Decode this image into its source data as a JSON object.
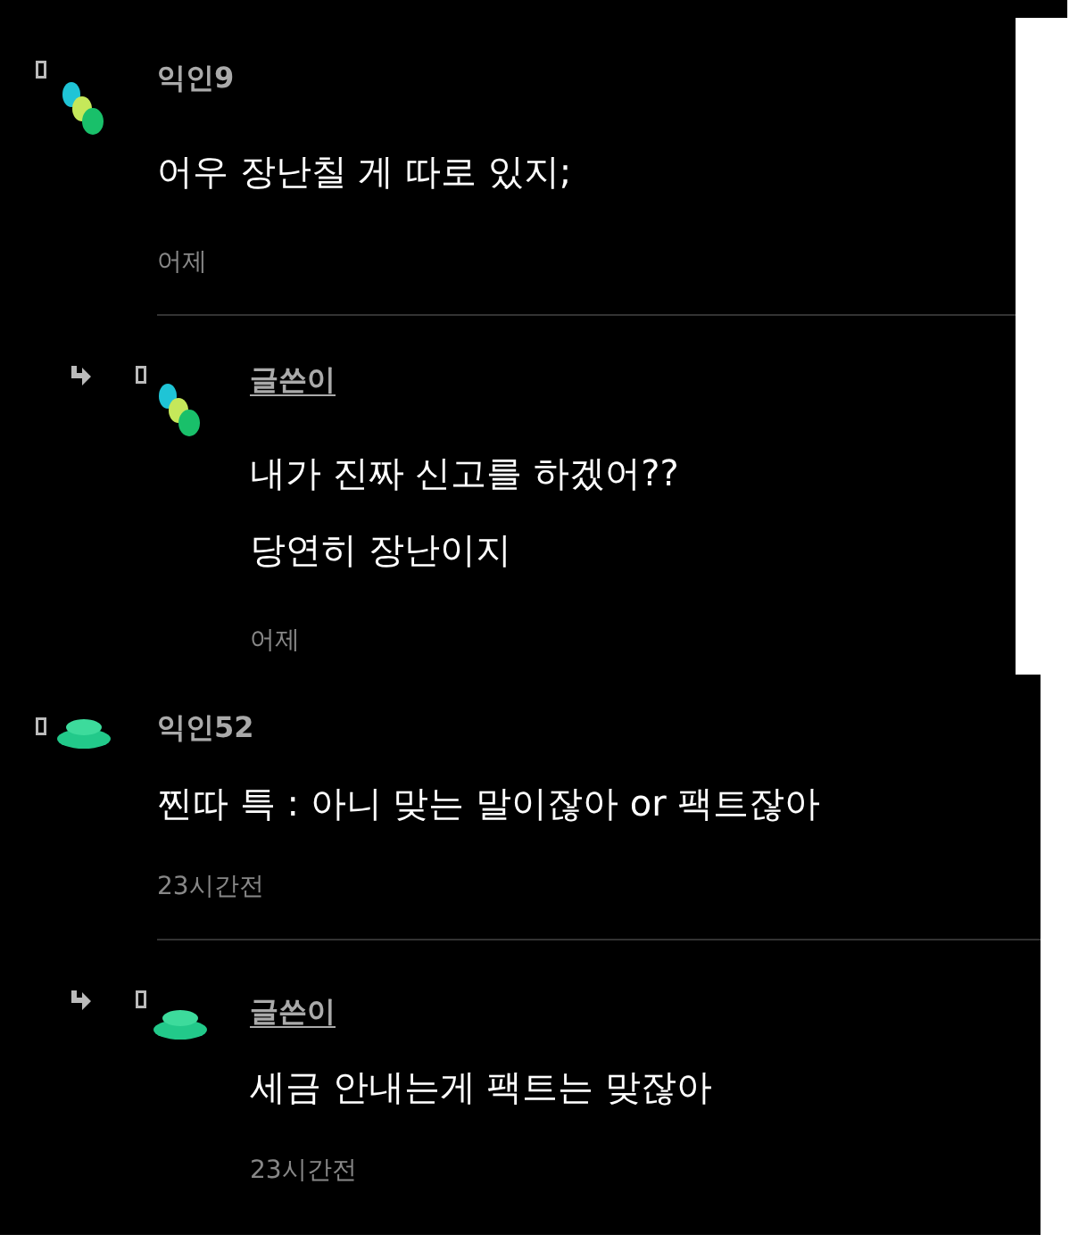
{
  "comments": [
    {
      "author": "익인9",
      "is_writer": false,
      "kind": "dots",
      "lines": [
        "어우 장난칠 게 따로 있지;"
      ],
      "time": "어제",
      "replies": [
        {
          "author": "글쓴이",
          "is_writer": true,
          "kind": "dots",
          "lines": [
            "내가 진짜 신고를 하겠어??",
            "당연히 장난이지"
          ],
          "time": "어제"
        }
      ]
    },
    {
      "author": "익인52",
      "is_writer": false,
      "kind": "mound",
      "lines": [
        "찐따 특 : 아니 맞는 말이잖아 or 팩트잖아"
      ],
      "time": "23시간전",
      "replies": [
        {
          "author": "글쓴이",
          "is_writer": true,
          "kind": "mound",
          "lines": [
            "세금 안내는게 팩트는 맞잖아"
          ],
          "time": "23시간전"
        }
      ]
    }
  ]
}
